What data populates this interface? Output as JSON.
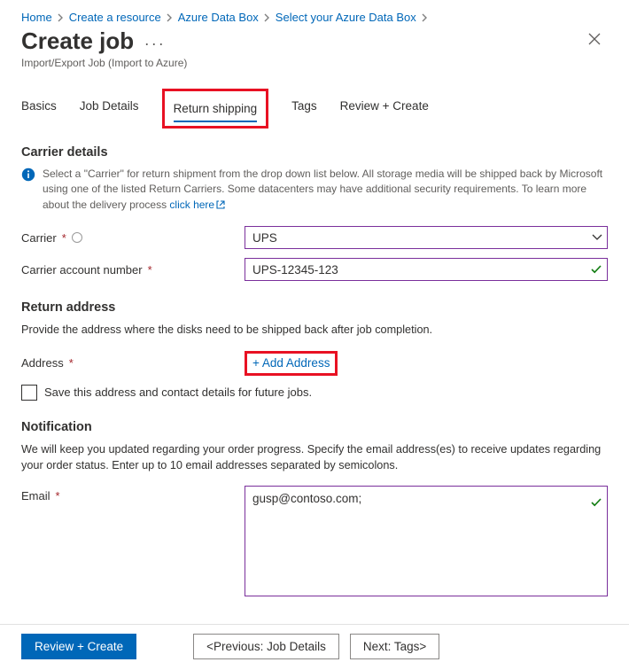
{
  "breadcrumbs": [
    "Home",
    "Create a resource",
    "Azure Data Box",
    "Select your Azure Data Box"
  ],
  "title": "Create job",
  "subtitle": "Import/Export Job (Import to Azure)",
  "tabs": {
    "t0": "Basics",
    "t1": "Job Details",
    "t2": "Return shipping",
    "t3": "Tags",
    "t4": "Review + Create"
  },
  "carrier": {
    "heading": "Carrier details",
    "info": "Select a \"Carrier\" for return shipment from the drop down list below. All storage media will be shipped back by Microsoft using one of the listed Return Carriers. Some datacenters may have additional security requirements. To learn more about the delivery process ",
    "info_link": "click here",
    "label": "Carrier",
    "value": "UPS",
    "acct_label": "Carrier account number",
    "acct_value": "UPS-12345-123"
  },
  "return_addr": {
    "heading": "Return address",
    "desc": "Provide the address where the disks need to be shipped back after job completion.",
    "label": "Address",
    "add_link": "+ Add Address",
    "save_label": "Save this address and contact details for future jobs."
  },
  "notification": {
    "heading": "Notification",
    "desc": "We will keep you updated regarding your order progress. Specify the email address(es) to receive updates regarding your order status. Enter up to 10 email addresses separated by semicolons.",
    "label": "Email",
    "value": "gusp@contoso.com;"
  },
  "buttons": {
    "review": "Review + Create",
    "prev": "<Previous: Job Details",
    "next": "Next: Tags>"
  }
}
